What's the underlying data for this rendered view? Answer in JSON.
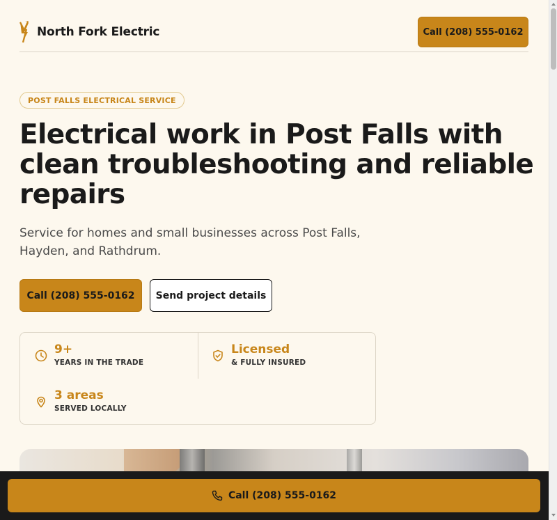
{
  "brand": {
    "name": "North Fork Electric",
    "accent_color": "#c8861a",
    "logo_icon": "lightning-bolt-icon"
  },
  "header": {
    "call_label": "Call (208) 555-0162"
  },
  "hero": {
    "badge": "POST FALLS ELECTRICAL SERVICE",
    "title": "Electrical work in Post Falls with clean troubleshooting and reliable repairs",
    "subtitle": "Service for homes and small businesses across Post Falls, Hayden, and Rathdrum.",
    "primary_button": "Call (208) 555-0162",
    "secondary_button": "Send project details"
  },
  "stats": [
    {
      "icon": "clock-icon",
      "value": "9+",
      "label": "YEARS IN THE TRADE"
    },
    {
      "icon": "shield-check-icon",
      "value": "Licensed",
      "label": "& FULLY INSURED"
    },
    {
      "icon": "map-pin-icon",
      "value": "3 areas",
      "label": "SERVED LOCALLY"
    }
  ],
  "sticky": {
    "call_label": "Call (208) 555-0162",
    "icon": "phone-icon"
  }
}
